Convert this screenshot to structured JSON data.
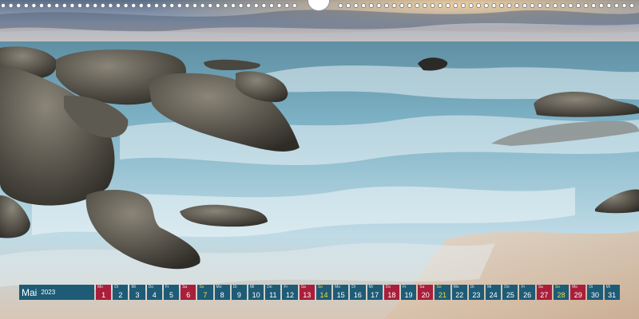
{
  "calendar": {
    "month": "Mai",
    "year": "2023",
    "days": [
      {
        "abbr": "Mo",
        "num": "1",
        "kind": "holiday"
      },
      {
        "abbr": "Di",
        "num": "2",
        "kind": "weekday"
      },
      {
        "abbr": "Mi",
        "num": "3",
        "kind": "weekday"
      },
      {
        "abbr": "Do",
        "num": "4",
        "kind": "weekday"
      },
      {
        "abbr": "Fr",
        "num": "5",
        "kind": "weekday"
      },
      {
        "abbr": "Sa",
        "num": "6",
        "kind": "saturday"
      },
      {
        "abbr": "So",
        "num": "7",
        "kind": "sunday"
      },
      {
        "abbr": "Mo",
        "num": "8",
        "kind": "weekday"
      },
      {
        "abbr": "Di",
        "num": "9",
        "kind": "weekday"
      },
      {
        "abbr": "Mi",
        "num": "10",
        "kind": "weekday"
      },
      {
        "abbr": "Do",
        "num": "11",
        "kind": "weekday"
      },
      {
        "abbr": "Fr",
        "num": "12",
        "kind": "weekday"
      },
      {
        "abbr": "Sa",
        "num": "13",
        "kind": "saturday"
      },
      {
        "abbr": "So",
        "num": "14",
        "kind": "sunday"
      },
      {
        "abbr": "Mo",
        "num": "15",
        "kind": "weekday"
      },
      {
        "abbr": "Di",
        "num": "16",
        "kind": "weekday"
      },
      {
        "abbr": "Mi",
        "num": "17",
        "kind": "weekday"
      },
      {
        "abbr": "Do",
        "num": "18",
        "kind": "holiday"
      },
      {
        "abbr": "Fr",
        "num": "19",
        "kind": "weekday"
      },
      {
        "abbr": "Sa",
        "num": "20",
        "kind": "saturday"
      },
      {
        "abbr": "So",
        "num": "21",
        "kind": "sunday"
      },
      {
        "abbr": "Mo",
        "num": "22",
        "kind": "weekday"
      },
      {
        "abbr": "Di",
        "num": "23",
        "kind": "weekday"
      },
      {
        "abbr": "Mi",
        "num": "24",
        "kind": "weekday"
      },
      {
        "abbr": "Do",
        "num": "25",
        "kind": "weekday"
      },
      {
        "abbr": "Fr",
        "num": "26",
        "kind": "weekday"
      },
      {
        "abbr": "Sa",
        "num": "27",
        "kind": "saturday"
      },
      {
        "abbr": "So",
        "num": "28",
        "kind": "sunday"
      },
      {
        "abbr": "Mo",
        "num": "29",
        "kind": "holiday"
      },
      {
        "abbr": "Di",
        "num": "30",
        "kind": "weekday"
      },
      {
        "abbr": "Mi",
        "num": "31",
        "kind": "weekday"
      }
    ]
  },
  "colors": {
    "weekday": "#1e5b76",
    "holiday": "#a91f3b",
    "saturday": "#a91f3b",
    "sunday": "#1e5b76",
    "sunday_text": "#f0df3a"
  }
}
